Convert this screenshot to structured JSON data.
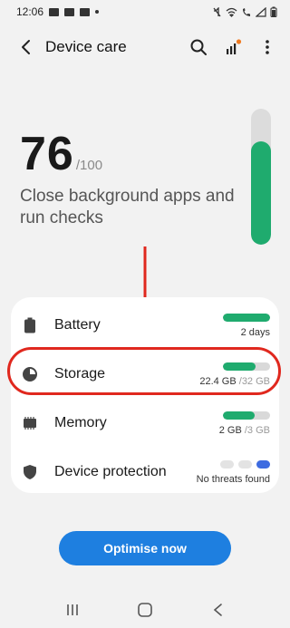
{
  "status_bar": {
    "time": "12:06"
  },
  "app_bar": {
    "title": "Device care",
    "back_icon": "chevron-left-icon",
    "actions": [
      "search-icon",
      "signal-badge-icon",
      "more-vert-icon"
    ],
    "badge_color": "#f07b22"
  },
  "score": {
    "value": "76",
    "max": "/100",
    "advice": "Close background apps and run checks",
    "gauge_level": 0.76,
    "accent": "#1fab6e"
  },
  "rows": [
    {
      "label": "Battery",
      "icon": "battery-icon",
      "bar_level": 1.0,
      "sub": "2 days"
    },
    {
      "label": "Storage",
      "icon": "pie-chart-icon",
      "bar_level": 0.7,
      "used": "22.4 GB",
      "total": " /32 GB"
    },
    {
      "label": "Memory",
      "icon": "memory-chip-icon",
      "bar_level": 0.67,
      "used": "2 GB",
      "total": " /3 GB"
    },
    {
      "label": "Device protection",
      "icon": "shield-icon",
      "sub": "No threats found",
      "dots_active": 1
    }
  ],
  "highlight_color": "#e0281e",
  "primary_button": {
    "label": "Optimise now",
    "color": "#1e7fe0"
  },
  "nav": [
    "recent-apps-icon",
    "home-icon",
    "back-icon"
  ]
}
